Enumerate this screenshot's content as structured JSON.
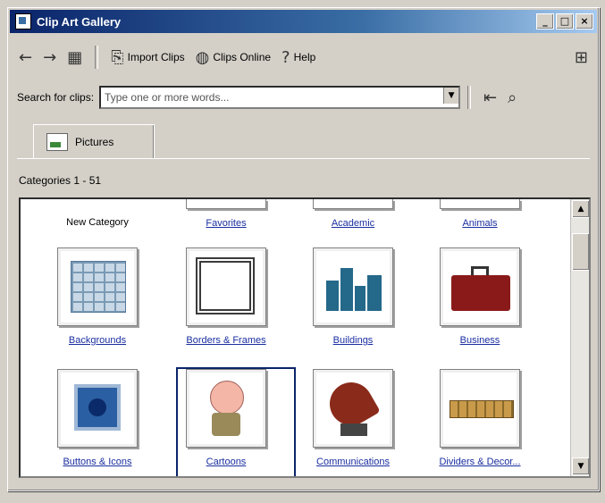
{
  "window": {
    "title": "Clip Art Gallery",
    "controls": [
      "_",
      "□",
      "×"
    ]
  },
  "toolbar": {
    "back_icon": "back-arrow",
    "forward_icon": "forward-arrow",
    "all_categories_icon": "all-categories",
    "import_label": "Import Clips",
    "online_label": "Clips Online",
    "help_label": "Help",
    "change_view_icon": "change-view"
  },
  "search": {
    "label": "Search for clips:",
    "placeholder": "Type one or more words...",
    "dropdown": "▼"
  },
  "tabs": [
    {
      "label": "Pictures",
      "icon": "picture-icon"
    }
  ],
  "categories_label": "Categories 1 - 51",
  "pane": {
    "new_category_label": "New Category",
    "top_row": [
      "Favorites",
      "Academic",
      "Animals"
    ],
    "items": [
      {
        "label": "Backgrounds",
        "art": "grid"
      },
      {
        "label": "Borders & Frames",
        "art": "frame"
      },
      {
        "label": "Buildings",
        "art": "buildings"
      },
      {
        "label": "Business",
        "art": "briefcase"
      },
      {
        "label": "Buttons & Icons",
        "art": "button"
      },
      {
        "label": "Cartoons",
        "art": "cartoon-kid",
        "selected": true
      },
      {
        "label": "Communications",
        "art": "satellite-dish"
      },
      {
        "label": "Dividers & Decor...",
        "art": "decorative-border"
      }
    ]
  },
  "scrollbar": {
    "up": "▲",
    "down": "▼"
  }
}
